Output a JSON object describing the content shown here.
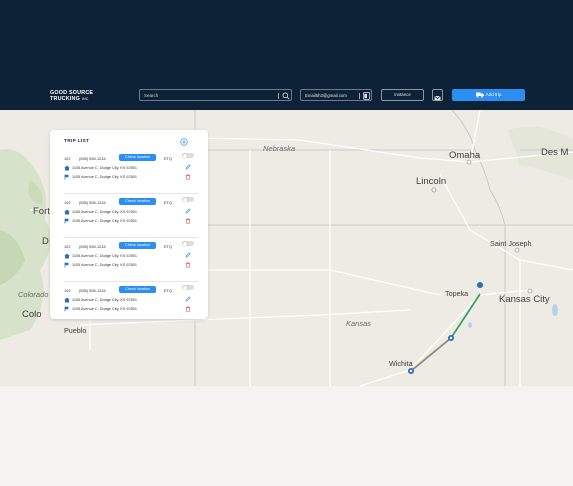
{
  "header": {
    "logo_line1": "GOOD SOURCE",
    "logo_line2": "TRUCKING",
    "logo_suffix": "INC",
    "search_placeholder": "Search",
    "email": "Email5h3@gmail.com",
    "instance_label": "Instance",
    "add_trip_label": "Add trip"
  },
  "map": {
    "states": [
      "Nebraska",
      "Kansas",
      "Colorado"
    ],
    "cities": [
      "Omaha",
      "Des M",
      "Lincoln",
      "Saint Joseph",
      "Topeka",
      "Kansas City",
      "Wichita",
      "Pueblo",
      "Colo",
      "Fort",
      "D"
    ],
    "route_color": "#2e9e58",
    "route_color_secondary": "#7b8a96"
  },
  "trip_list": {
    "title": "TRIP LIST",
    "trips": [
      {
        "id": "102",
        "phone": "(555) 555-1234",
        "check_label": "Check location",
        "eta": "ETQ",
        "origin": "1105 Avenue C, Dodge City, KS 67801",
        "destination": "1105 Avenue C, Dodge City, KS 67801"
      },
      {
        "id": "102",
        "phone": "(555) 555-1234",
        "check_label": "Check location",
        "eta": "ETQ",
        "origin": "1105 Avenue C, Dodge City, KS 67801",
        "destination": "1105 Avenue C, Dodge City, KS 67801"
      },
      {
        "id": "102",
        "phone": "(555) 555-1234",
        "check_label": "Check location",
        "eta": "ETQ",
        "origin": "1105 Avenue C, Dodge City, KS 67801",
        "destination": "1105 Avenue C, Dodge City, KS 67801"
      },
      {
        "id": "102",
        "phone": "(555) 555-1234",
        "check_label": "Check location",
        "eta": "ETQ",
        "origin": "1105 Avenue C, Dodge City, KS 67801",
        "destination": "1105 Avenue C, Dodge City, KS 67801"
      }
    ]
  },
  "colors": {
    "header_bg": "#0d2236",
    "accent": "#2b8ef0",
    "delete": "#e05454"
  },
  "icons": [
    "search-icon",
    "user-card-icon",
    "mail-icon",
    "truck-icon",
    "plus-circle-icon",
    "home-icon",
    "flag-icon",
    "pencil-icon",
    "trash-icon",
    "map-pin-icon"
  ]
}
